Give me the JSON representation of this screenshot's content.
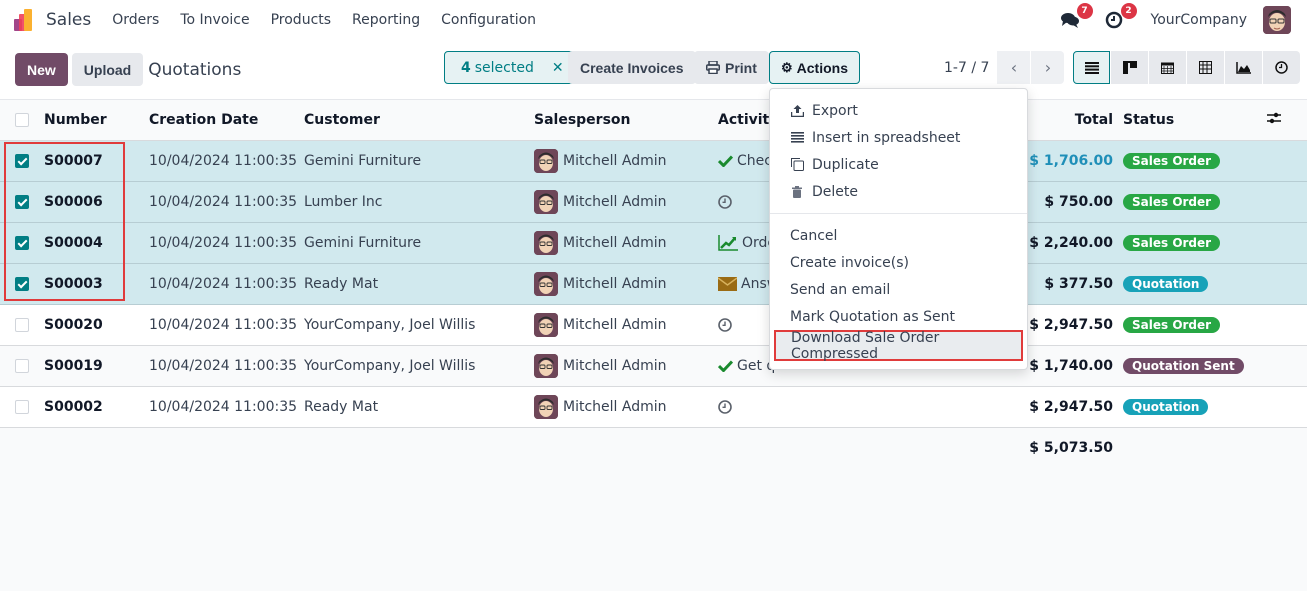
{
  "topbar": {
    "app_name": "Sales",
    "menu": [
      "Orders",
      "To Invoice",
      "Products",
      "Reporting",
      "Configuration"
    ],
    "messages_badge": "7",
    "activities_badge": "2",
    "company": "YourCompany"
  },
  "control": {
    "new_label": "New",
    "upload_label": "Upload",
    "title": "Quotations",
    "selected_count": "4",
    "selected_label": "selected",
    "create_invoices_label": "Create Invoices",
    "print_label": "Print",
    "actions_label": "Actions",
    "pager": "1-7 / 7"
  },
  "table": {
    "headers": {
      "number": "Number",
      "creation_date": "Creation Date",
      "customer": "Customer",
      "salesperson": "Salesperson",
      "activities": "Activities",
      "total": "Total",
      "status": "Status"
    },
    "rows": [
      {
        "number": "S00007",
        "date": "10/04/2024 11:00:35",
        "customer": "Gemini Furniture",
        "salesperson": "Mitchell Admin",
        "activity_icon": "check-icon",
        "activity": "Check",
        "total": "$ 1,706.00",
        "status": "Sales Order",
        "selected": true
      },
      {
        "number": "S00006",
        "date": "10/04/2024 11:00:35",
        "customer": "Lumber Inc",
        "salesperson": "Mitchell Admin",
        "activity_icon": "clock-icon",
        "activity": "",
        "total": "$ 750.00",
        "status": "Sales Order",
        "selected": true
      },
      {
        "number": "S00004",
        "date": "10/04/2024 11:00:35",
        "customer": "Gemini Furniture",
        "salesperson": "Mitchell Admin",
        "activity_icon": "chart-icon",
        "activity": "Order",
        "total": "$ 2,240.00",
        "status": "Sales Order",
        "selected": true
      },
      {
        "number": "S00003",
        "date": "10/04/2024 11:00:35",
        "customer": "Ready Mat",
        "salesperson": "Mitchell Admin",
        "activity_icon": "envelope-icon",
        "activity": "Answer",
        "total": "$ 377.50",
        "status": "Quotation",
        "selected": true
      },
      {
        "number": "S00020",
        "date": "10/04/2024 11:00:35",
        "customer": "YourCompany, Joel Willis",
        "salesperson": "Mitchell Admin",
        "activity_icon": "clock-icon",
        "activity": "",
        "total": "$ 2,947.50",
        "status": "Sales Order",
        "selected": false
      },
      {
        "number": "S00019",
        "date": "10/04/2024 11:00:35",
        "customer": "YourCompany, Joel Willis",
        "salesperson": "Mitchell Admin",
        "activity_icon": "check-icon",
        "activity": "Get quote confirmation",
        "total": "$ 1,740.00",
        "status": "Quotation Sent",
        "selected": false
      },
      {
        "number": "S00002",
        "date": "10/04/2024 11:00:35",
        "customer": "Ready Mat",
        "salesperson": "Mitchell Admin",
        "activity_icon": "clock-icon",
        "activity": "",
        "total": "$ 2,947.50",
        "status": "Quotation",
        "selected": false
      }
    ],
    "sum_total": "$ 5,073.50"
  },
  "status_colors": {
    "Sales Order": "#28a745",
    "Quotation": "#17a2b8",
    "Quotation Sent": "#714b67"
  },
  "actions_menu": {
    "group1": [
      {
        "icon": "upload-icon",
        "label": "Export"
      },
      {
        "icon": "list-icon",
        "label": "Insert in spreadsheet"
      },
      {
        "icon": "copy-icon",
        "label": "Duplicate"
      },
      {
        "icon": "trash-icon",
        "label": "Delete"
      }
    ],
    "group2": [
      {
        "label": "Cancel"
      },
      {
        "label": "Create invoice(s)"
      },
      {
        "label": "Send an email"
      },
      {
        "label": "Mark Quotation as Sent"
      },
      {
        "label": "Download Sale Order Compressed",
        "highlighted": true
      }
    ]
  }
}
